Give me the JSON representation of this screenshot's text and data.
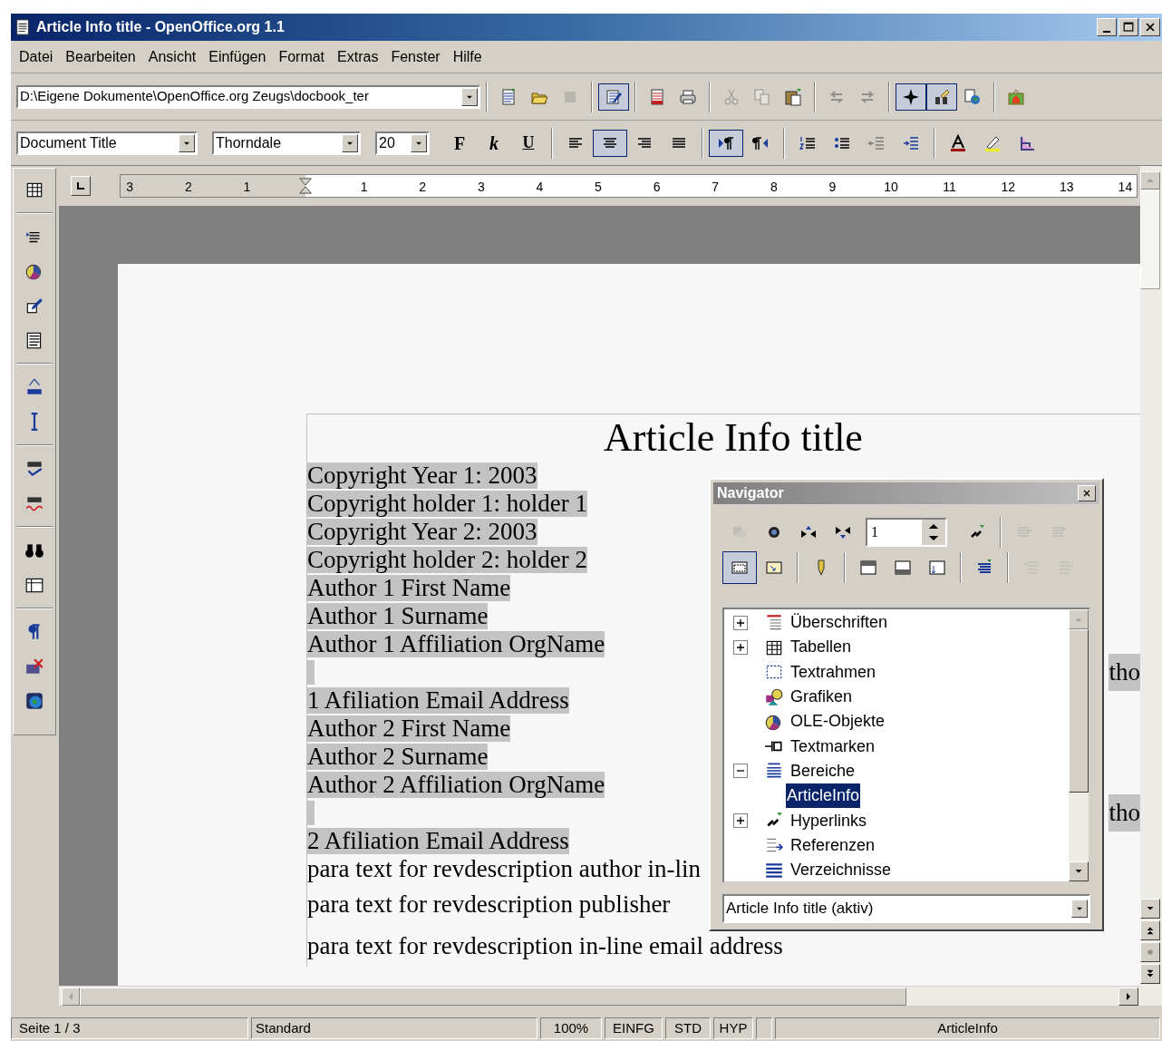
{
  "window": {
    "title": "Article Info title - OpenOffice.org 1.1"
  },
  "menu": [
    "Datei",
    "Bearbeiten",
    "Ansicht",
    "Einfügen",
    "Format",
    "Extras",
    "Fenster",
    "Hilfe"
  ],
  "function_bar": {
    "url": "D:\\Eigene Dokumente\\OpenOffice.org Zeugs\\docbook_ter",
    "buttons": [
      {
        "pressed": false,
        "disabled": false
      },
      {
        "pressed": false,
        "disabled": false
      },
      {
        "pressed": false,
        "disabled": true
      },
      {
        "pressed": true,
        "disabled": false
      },
      {
        "pressed": false,
        "disabled": false
      },
      {
        "pressed": false,
        "disabled": false
      },
      {
        "pressed": false,
        "disabled": true
      },
      {
        "pressed": false,
        "disabled": true
      },
      {
        "pressed": false,
        "disabled": false
      },
      {
        "pressed": false,
        "disabled": true
      },
      {
        "pressed": false,
        "disabled": true
      },
      {
        "pressed": true,
        "disabled": false
      },
      {
        "pressed": true,
        "disabled": false
      },
      {
        "pressed": false,
        "disabled": false
      },
      {
        "pressed": false,
        "disabled": false
      }
    ]
  },
  "object_bar": {
    "paragraph_style": "Document Title",
    "font": "Thorndale",
    "size": "20",
    "format_buttons": [
      {
        "label": "F"
      },
      {
        "label": "k"
      },
      {
        "label": "U"
      }
    ],
    "buttons": [
      {
        "pressed": false,
        "disabled": false
      },
      {
        "pressed": true,
        "disabled": false
      },
      {
        "pressed": false,
        "disabled": false
      },
      {
        "pressed": false,
        "disabled": false
      },
      {
        "pressed": true,
        "disabled": false
      },
      {
        "pressed": false,
        "disabled": false
      },
      {
        "pressed": false,
        "disabled": false
      },
      {
        "pressed": false,
        "disabled": false
      },
      {
        "pressed": false,
        "disabled": true
      },
      {
        "pressed": false,
        "disabled": false
      },
      {
        "pressed": false,
        "disabled": false
      },
      {
        "pressed": false,
        "disabled": false
      },
      {
        "pressed": false,
        "disabled": false
      }
    ]
  },
  "ruler": {
    "left_labels": [
      "3",
      "2",
      "1"
    ],
    "right_labels": [
      "1",
      "2",
      "3",
      "4",
      "5",
      "6",
      "7",
      "8",
      "9",
      "10",
      "11",
      "12",
      "13",
      "14"
    ]
  },
  "document": {
    "title": "Article Info title",
    "lines": [
      {
        "kind": "line",
        "text": "Copyright Year 1: 2003",
        "highlighted": true
      },
      {
        "kind": "line",
        "text": "Copyright holder 1: holder 1",
        "highlighted": true
      },
      {
        "kind": "line",
        "text": "Copyright Year 2: 2003",
        "highlighted": true
      },
      {
        "kind": "line",
        "text": "Copyright holder 2: holder 2",
        "highlighted": true
      },
      {
        "kind": "line",
        "text": "Author 1 First Name",
        "highlighted": true
      },
      {
        "kind": "line",
        "text": "Author 1 Surname",
        "highlighted": true
      },
      {
        "kind": "line",
        "text": "Author 1 Affiliation OrgName",
        "highlighted": true
      },
      {
        "kind": "blank",
        "highlighted": true,
        "fragment": "tho"
      },
      {
        "kind": "line",
        "text": "1 Afiliation Email Address",
        "highlighted": true
      },
      {
        "kind": "line",
        "text": "Author 2 First Name",
        "highlighted": true
      },
      {
        "kind": "line",
        "text": "Author 2 Surname",
        "highlighted": true
      },
      {
        "kind": "line",
        "text": "Author 2 Affiliation OrgName",
        "highlighted": true
      },
      {
        "kind": "blank",
        "highlighted": true,
        "fragment": "tho"
      },
      {
        "kind": "line",
        "text": "2 Afiliation Email Address",
        "highlighted": true
      },
      {
        "kind": "line",
        "text": "para text for revdescription author in-lin",
        "highlighted": false
      },
      {
        "kind": "para",
        "text": "para text for revdescription publisher",
        "highlighted": false
      },
      {
        "kind": "para",
        "text": "para text for revdescription in-line email address",
        "highlighted": false
      }
    ]
  },
  "navigator": {
    "title": "Navigator",
    "page_number": "1",
    "buttons": [
      {
        "pressed": false,
        "disabled": true
      },
      {
        "pressed": false,
        "disabled": false
      },
      {
        "pressed": false,
        "disabled": false
      },
      {
        "pressed": false,
        "disabled": false
      },
      {
        "pressed": false,
        "disabled": false
      },
      {
        "pressed": false,
        "disabled": true
      },
      {
        "pressed": false,
        "disabled": true
      },
      {
        "pressed": true,
        "disabled": false
      },
      {
        "pressed": false,
        "disabled": false
      },
      {
        "pressed": false,
        "disabled": false
      },
      {
        "pressed": false,
        "disabled": false
      },
      {
        "pressed": false,
        "disabled": false
      },
      {
        "pressed": false,
        "disabled": false
      },
      {
        "pressed": false,
        "disabled": false
      },
      {
        "pressed": false,
        "disabled": true
      },
      {
        "pressed": false,
        "disabled": true
      }
    ],
    "tree": [
      {
        "label": "Überschriften",
        "kind": "folder",
        "expanded": false,
        "selected": false
      },
      {
        "label": "Tabellen",
        "kind": "folder",
        "expanded": false,
        "selected": false
      },
      {
        "label": "Textrahmen",
        "kind": "plain",
        "selected": false
      },
      {
        "label": "Grafiken",
        "kind": "plain",
        "selected": false
      },
      {
        "label": "OLE-Objekte",
        "kind": "plain",
        "selected": false
      },
      {
        "label": "Textmarken",
        "kind": "plain",
        "selected": false
      },
      {
        "label": "Bereiche",
        "kind": "folder",
        "expanded": true,
        "selected": false,
        "children": [
          {
            "label": "ArticleInfo",
            "selected": true
          }
        ]
      },
      {
        "label": "Hyperlinks",
        "kind": "folder",
        "expanded": false,
        "selected": false
      },
      {
        "label": "Referenzen",
        "kind": "plain",
        "selected": false
      },
      {
        "label": "Verzeichnisse",
        "kind": "plain",
        "selected": false
      }
    ],
    "document": "Article Info title (aktiv)"
  },
  "status_bar": {
    "page": "Seite 1 / 3",
    "style": "Standard",
    "zoom": "100%",
    "insert_mode": "EINFG",
    "selection_mode": "STD",
    "hyperlink_mode": "HYP",
    "section": "ArticleInfo"
  }
}
